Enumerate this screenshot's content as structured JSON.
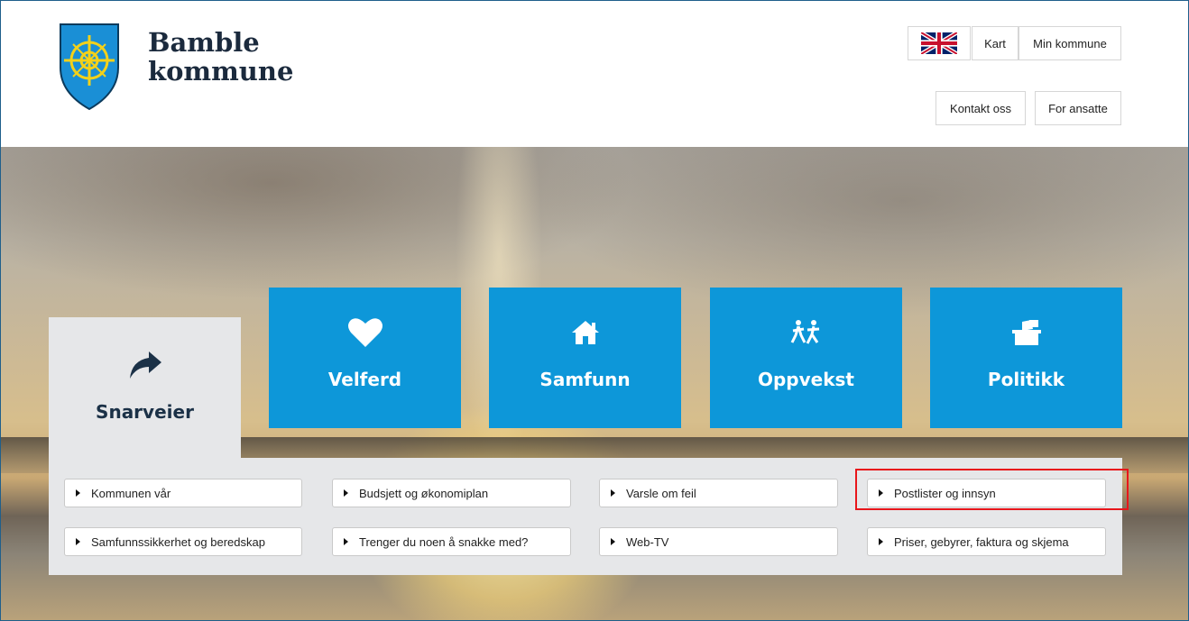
{
  "header": {
    "brand_line1": "Bamble",
    "brand_line2": "kommune",
    "language_flag": "uk-flag-icon",
    "top_links": {
      "kart": "Kart",
      "min_kommune": "Min kommune"
    },
    "buttons": {
      "kontakt": "Kontakt oss",
      "ansatte": "For ansatte"
    }
  },
  "tiles": [
    {
      "label": "Velferd",
      "icon": "heart-icon"
    },
    {
      "label": "Samfunn",
      "icon": "home-icon"
    },
    {
      "label": "Oppvekst",
      "icon": "children-icon"
    },
    {
      "label": "Politikk",
      "icon": "ballot-box-icon"
    }
  ],
  "shortcuts": {
    "tab_label": "Snarveier",
    "tab_icon": "share-arrow-icon",
    "links": [
      "Kommunen vår",
      "Budsjett og økonomiplan",
      "Varsle om feil",
      "Postlister og innsyn",
      "Samfunnssikkerhet og beredskap",
      "Trenger du noen å snakke med?",
      "Web-TV",
      "Priser, gebyrer, faktura og skjema"
    ]
  },
  "colors": {
    "tile_blue": "#0d97d9",
    "panel_grey": "#e6e7e9",
    "highlight_red": "#e8161b",
    "brand_text": "#1b2a3d"
  }
}
